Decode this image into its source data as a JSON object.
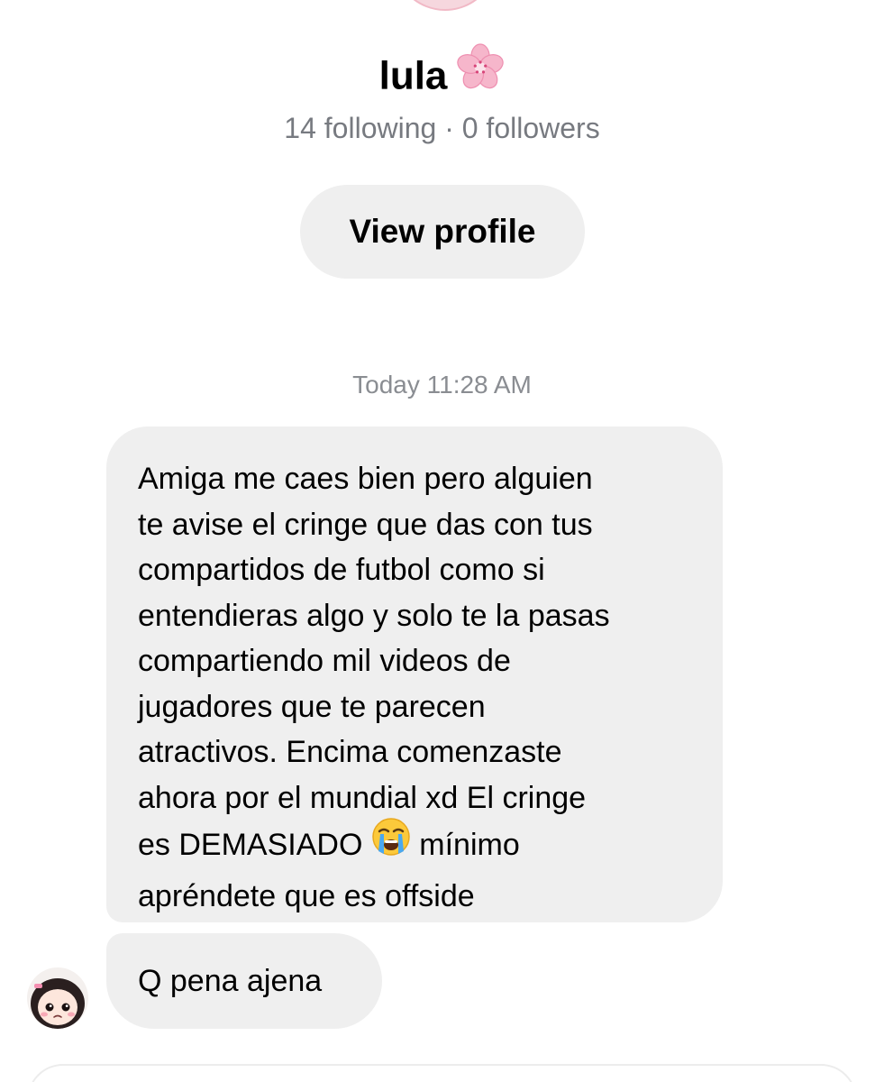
{
  "profile": {
    "name": "lula",
    "name_icon": "cherry-blossom-icon",
    "stats": "14 following · 0 followers",
    "view_profile_label": "View profile"
  },
  "thread": {
    "timestamp": "Today 11:28 AM",
    "messages": [
      {
        "lines": [
          "Amiga me caes bien pero alguien",
          "te avise el cringe que das con tus",
          "compartidos de futbol como si",
          "entendieras algo y solo te la pasas",
          "compartiendo mil videos de",
          "jugadores que te parecen",
          "atractivos. Encima comenzaste",
          "ahora por el mundial xd El cringe"
        ],
        "line9_before_emoji": "es DEMASIADO ",
        "emoji": "loudly-crying-face-icon",
        "line9_after_emoji": " mínimo",
        "line10": "apréndete que es offside"
      },
      {
        "text": "Q pena ajena"
      }
    ]
  },
  "colors": {
    "bubble_bg": "#efefef",
    "muted_text": "#777a80",
    "button_bg": "#efefef"
  }
}
